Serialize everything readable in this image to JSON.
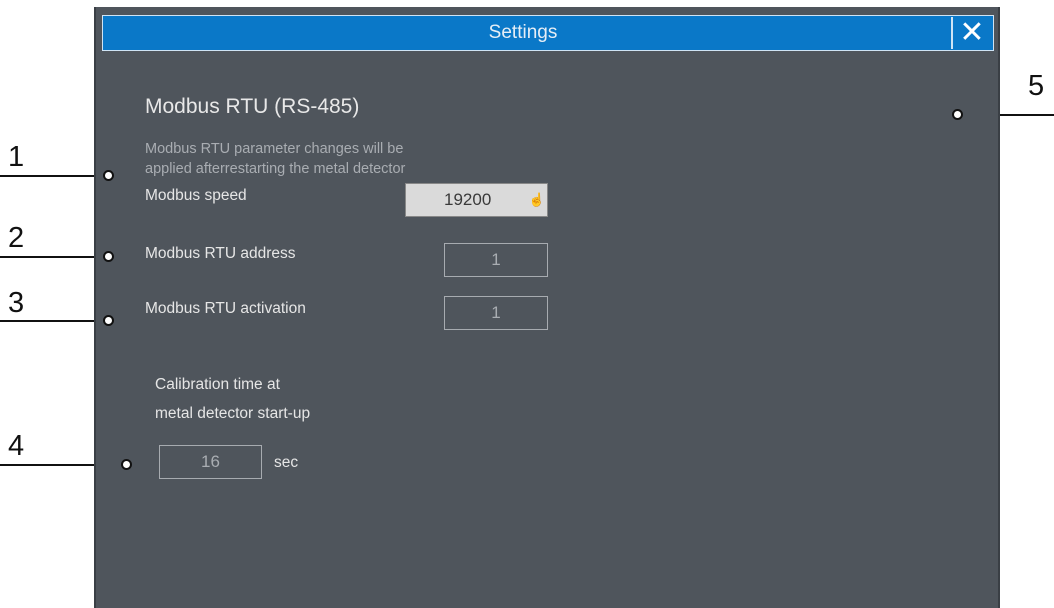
{
  "window": {
    "title": "Settings",
    "close_glyph": "✕"
  },
  "section": {
    "heading": "Modbus RTU (RS-485)",
    "note_line1": "Modbus RTU parameter changes will be",
    "note_line2": "applied afterrestarting the metal detector"
  },
  "fields": {
    "speed_label": "Modbus speed",
    "speed_value": "19200",
    "address_label": "Modbus RTU address",
    "address_value": "1",
    "activation_label": "Modbus RTU activation",
    "activation_value": "1",
    "calibration_label_line1": "Calibration time at",
    "calibration_label_line2": "metal detector start-up",
    "calibration_value": "16",
    "calibration_unit": "sec"
  },
  "callouts": [
    "1",
    "2",
    "3",
    "4",
    "5"
  ],
  "colors": {
    "titlebar": "#0a78c8",
    "panel": "#4f555c"
  }
}
